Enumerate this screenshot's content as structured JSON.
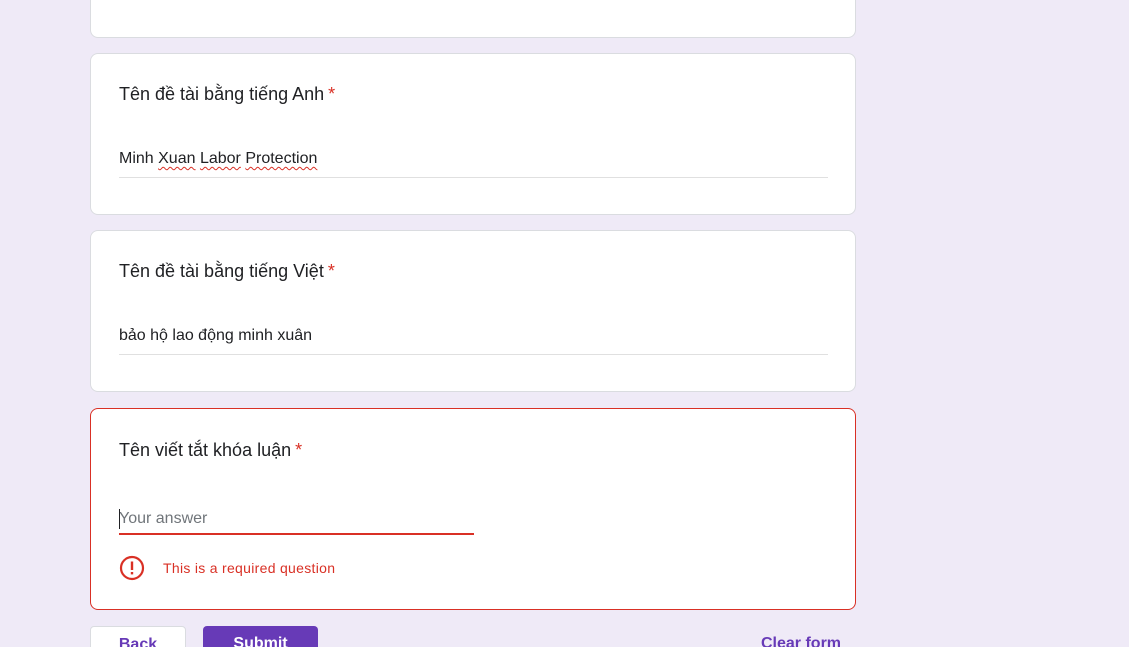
{
  "questions": [
    {
      "title": "Tên đề tài bằng tiếng Anh",
      "required_mark": "*",
      "answer_parts": [
        "Minh ",
        "Xuan",
        " ",
        "Labor",
        " ",
        "Protection"
      ]
    },
    {
      "title": "Tên đề tài bằng tiếng Việt",
      "required_mark": "*",
      "answer": "bảo hộ lao động minh xuân"
    },
    {
      "title": "Tên viết tắt khóa luận",
      "required_mark": "*",
      "value": "",
      "placeholder": "Your answer",
      "error": "This is a required question"
    }
  ],
  "buttons": {
    "back": "Back",
    "submit": "Submit",
    "clear": "Clear form"
  },
  "colors": {
    "accent": "#673ab7",
    "error": "#d93025",
    "background": "#efeaf7"
  },
  "icons": {
    "error": "error-circle-icon"
  }
}
